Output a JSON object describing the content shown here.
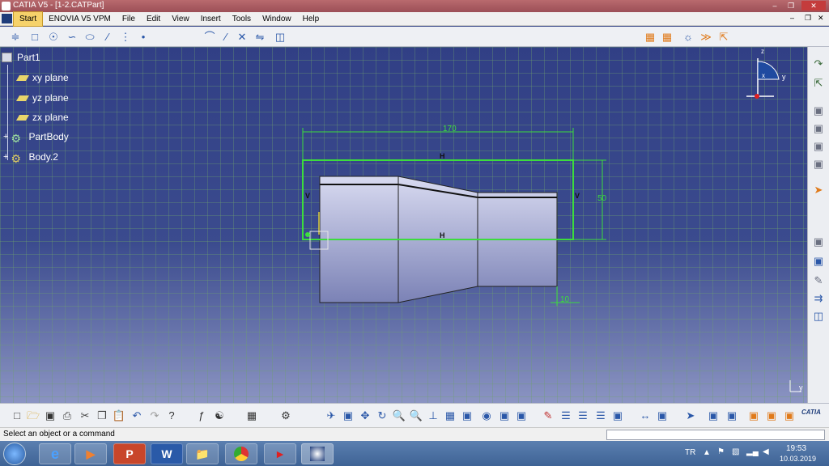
{
  "window": {
    "title": "CATIA V5 - [1-2.CATPart]"
  },
  "menu": [
    "Start",
    "ENOVIA V5 VPM",
    "File",
    "Edit",
    "View",
    "Insert",
    "Tools",
    "Window",
    "Help"
  ],
  "tree": {
    "root": "Part1",
    "items": [
      "xy plane",
      "yz plane",
      "zx plane",
      "PartBody",
      "Body.2"
    ]
  },
  "dimensions": {
    "width": "170",
    "height": "50",
    "offset": "10"
  },
  "constraints": {
    "horizontal": "H",
    "vertical": "V"
  },
  "compass": {
    "x": "x",
    "y": "y",
    "z": "z"
  },
  "status": {
    "message": "Select an object or a command"
  },
  "taskbar": {
    "language": "TR",
    "time": "19:53",
    "date": "10.03.2019",
    "apps": [
      "P",
      "W"
    ]
  },
  "colors": {
    "sketch_green": "#3cdc3c",
    "background_top": "#313f85",
    "accent_orange": "#e07a1a"
  },
  "icons": {
    "top_toolbar": [
      "profile-icon",
      "rectangle-icon",
      "circle-icon",
      "spline-icon",
      "ellipse-icon",
      "line-icon",
      "axis-icon",
      "point-icon",
      "corner-icon",
      "chamfer-icon",
      "trim-icon",
      "mirror-icon",
      "project-icon",
      "grid-icon",
      "snap-icon",
      "constraint-icon",
      "dimension-icon",
      "exit-workbench-icon"
    ]
  }
}
